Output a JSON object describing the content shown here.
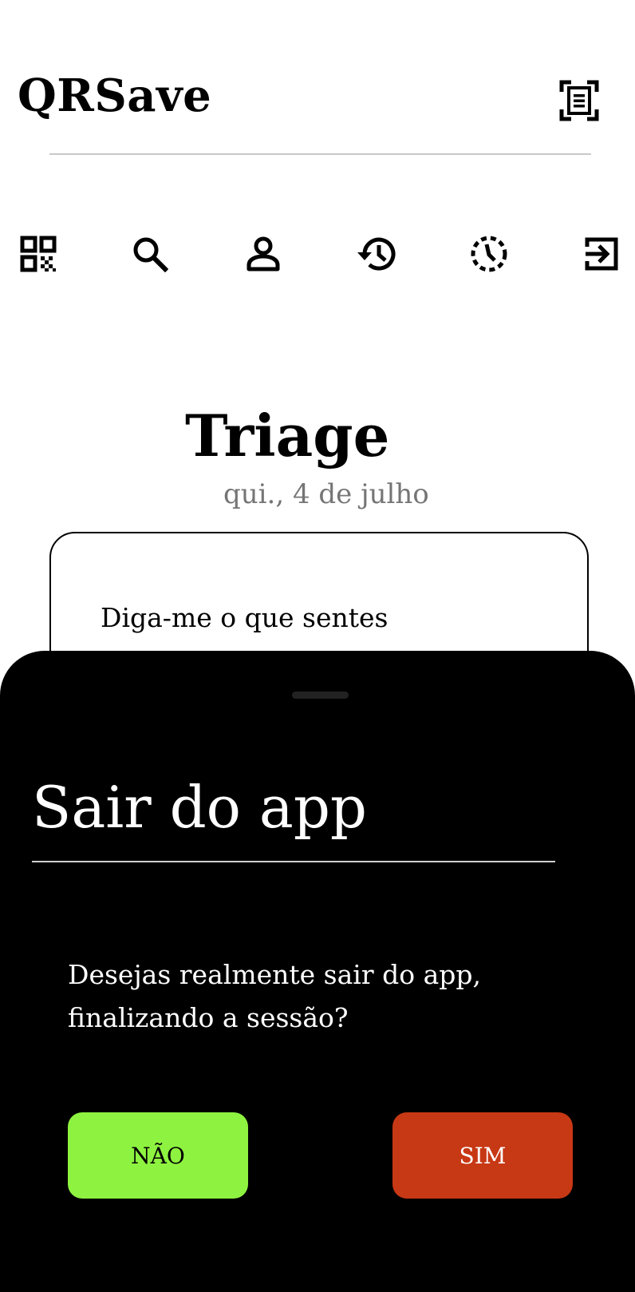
{
  "app": {
    "title": "QRSave",
    "scan_icon": "document-scanner-icon"
  },
  "nav": {
    "items": [
      {
        "name": "qr-code-icon"
      },
      {
        "name": "search-icon"
      },
      {
        "name": "person-icon"
      },
      {
        "name": "history-icon"
      },
      {
        "name": "pending-clock-icon"
      },
      {
        "name": "logout-icon"
      }
    ]
  },
  "main": {
    "title": "Triage",
    "date": "qui., 4 de julho",
    "card_prompt": "Diga-me o que sentes"
  },
  "dialog": {
    "title": "Sair do app",
    "message": "Desejas realmente sair do app, finalizando a sessão?",
    "no_label": "NÃO",
    "yes_label": "SIM",
    "no_color": "#8EF340",
    "yes_color": "#C73814"
  }
}
